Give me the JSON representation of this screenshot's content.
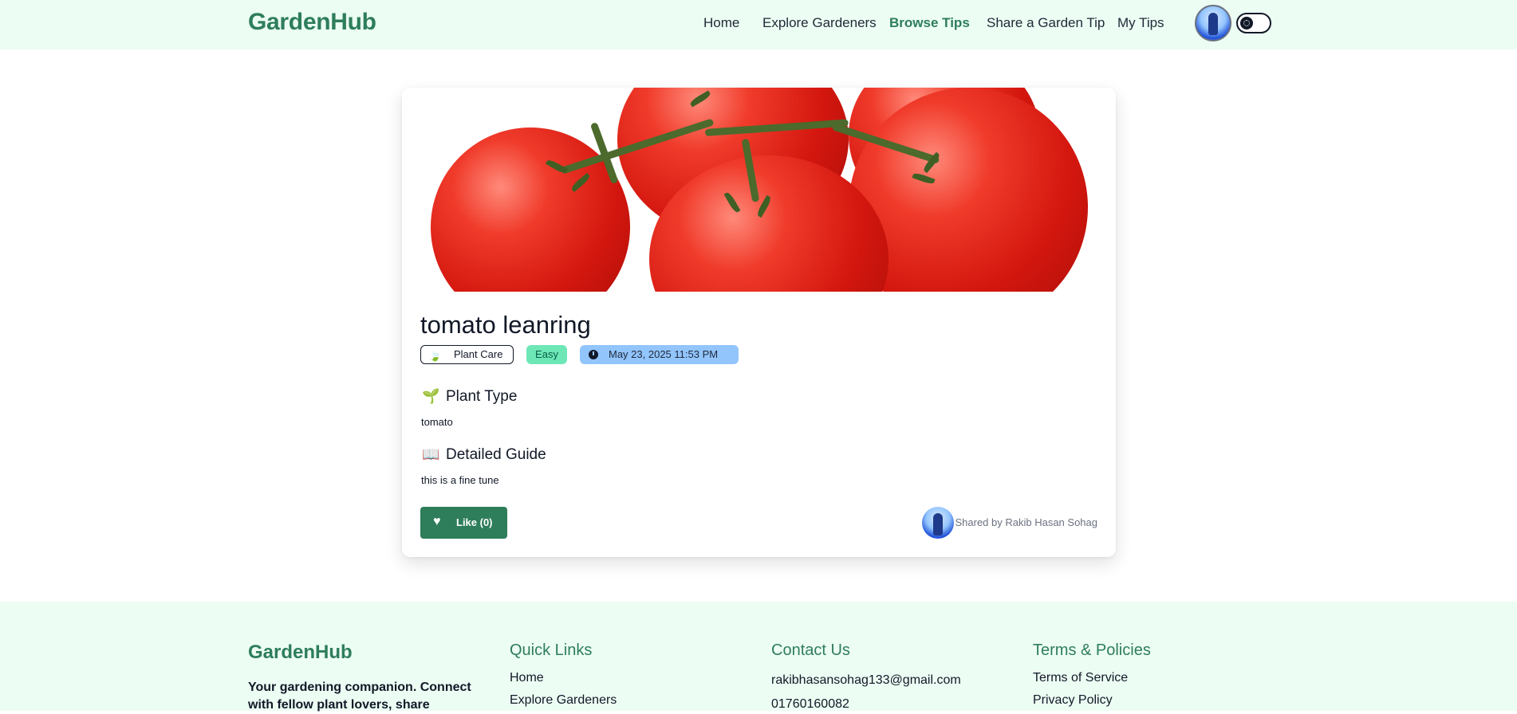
{
  "nav": {
    "brand": "GardenHub",
    "links": [
      {
        "label": "Home",
        "active": false
      },
      {
        "label": "Explore Gardeners",
        "active": false
      },
      {
        "label": "Browse Tips",
        "active": true
      },
      {
        "label": "Share a Garden Tip",
        "active": false
      },
      {
        "label": "My Tips",
        "active": false
      }
    ]
  },
  "tip": {
    "title": "tomato leanring",
    "category": "Plant Care",
    "category_icon": "leaf-icon",
    "difficulty": "Easy",
    "date": "May 23, 2025 11:53 PM",
    "date_icon": "clock-icon",
    "plant_type_heading": "Plant Type",
    "plant_type_emoji": "🌱",
    "plant_type": "tomato",
    "guide_heading": "Detailed Guide",
    "guide_emoji": "📖",
    "guide": "this is a fine tune",
    "like_label": "Like (0)",
    "shared_by": "Shared by Rakib Hasan Sohag"
  },
  "footer": {
    "brand": "GardenHub",
    "description": "Your gardening companion. Connect with fellow plant lovers, share",
    "quick_links_heading": "Quick Links",
    "quick_links": [
      "Home",
      "Explore Gardeners"
    ],
    "contact_heading": "Contact Us",
    "email": "rakibhasansohag133@gmail.com",
    "phone": "01760160082",
    "terms_heading": "Terms & Policies",
    "terms_links": [
      "Terms of Service",
      "Privacy Policy"
    ]
  },
  "colors": {
    "brand": "#2e7d5b",
    "nav_bg": "#ecfdf3",
    "difficulty_badge": "#6ee7b7",
    "date_badge": "#93c5fd"
  }
}
